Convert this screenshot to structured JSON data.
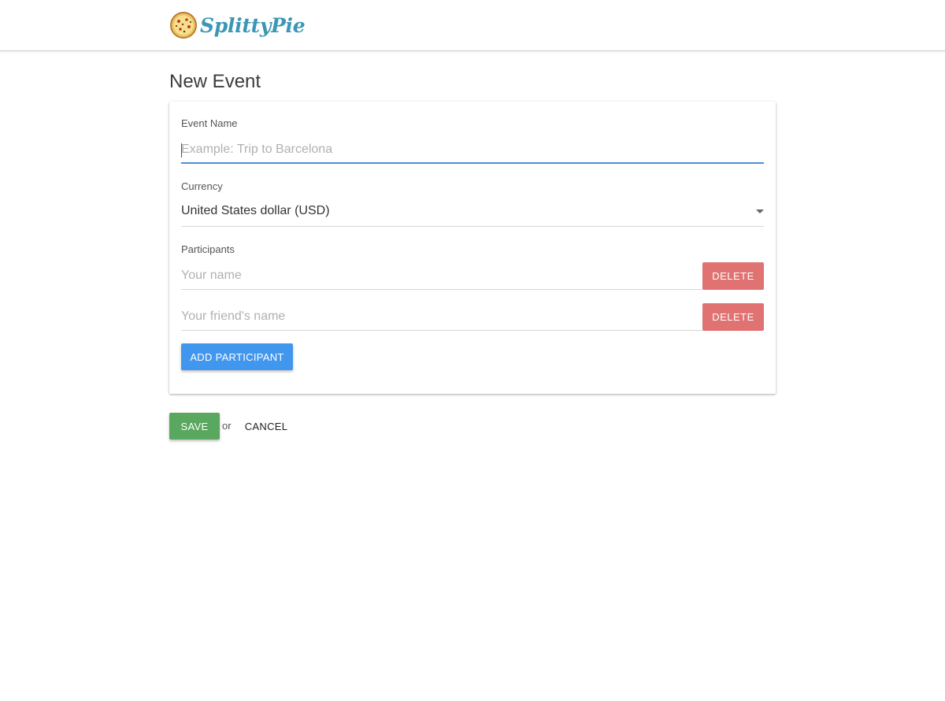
{
  "brand": {
    "name": "SplittyPie",
    "logo_icon": "pizza-icon",
    "text_color": "#3a97b5"
  },
  "page": {
    "title": "New Event"
  },
  "form": {
    "event_name": {
      "label": "Event Name",
      "value": "",
      "placeholder": "Example: Trip to Barcelona"
    },
    "currency": {
      "label": "Currency",
      "selected": "United States dollar (USD)"
    },
    "participants": {
      "label": "Participants",
      "items": [
        {
          "value": "",
          "placeholder": "Your name",
          "delete_label": "DELETE"
        },
        {
          "value": "",
          "placeholder": "Your friend's name",
          "delete_label": "DELETE"
        }
      ],
      "add_label": "ADD PARTICIPANT"
    }
  },
  "actions": {
    "save_label": "SAVE",
    "or_text": "or",
    "cancel_label": "CANCEL"
  },
  "colors": {
    "focus_blue": "#4a90d9",
    "add_button": "#4197ee",
    "delete_button": "#e07272",
    "save_button": "#5aa75f"
  }
}
